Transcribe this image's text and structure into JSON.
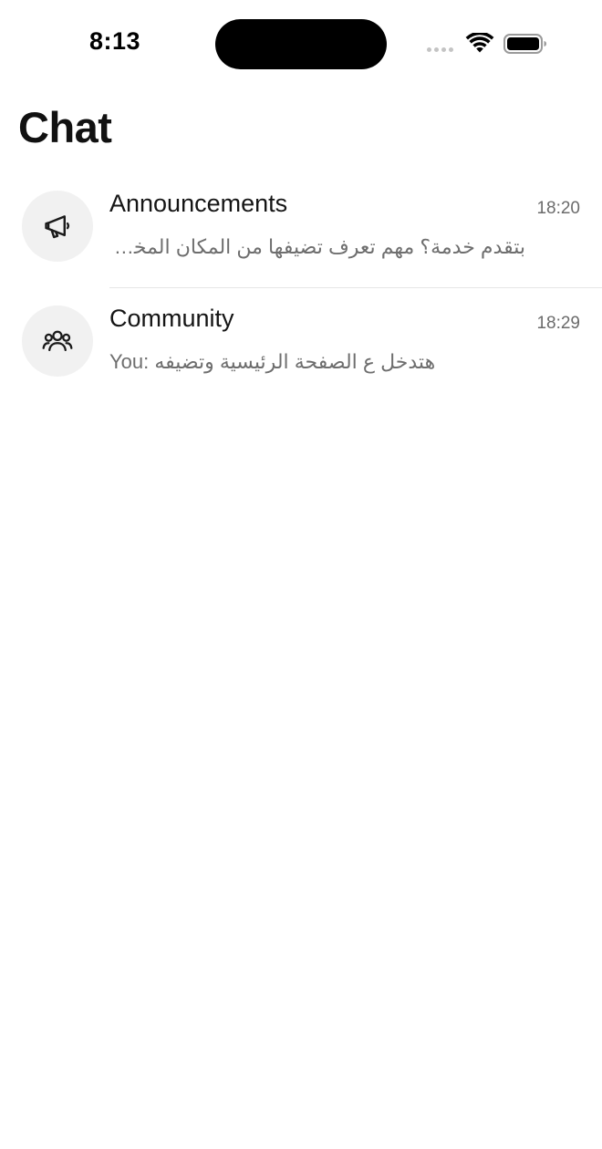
{
  "status_bar": {
    "time": "8:13"
  },
  "header": {
    "title": "Chat"
  },
  "chats": [
    {
      "name": "Announcements",
      "time": "18:20",
      "preview": "بتقدم خدمة؟ مهم تعرف تضيفها من المكان المخصص لها",
      "icon": "megaphone-icon"
    },
    {
      "name": "Community",
      "time": "18:29",
      "preview": "You: هتدخل ع الصفحة الرئيسية وتضيفه",
      "icon": "people-group-icon"
    }
  ],
  "colors": {
    "background": "#ffffff",
    "avatar_bg": "#f1f1f1",
    "secondary_text": "#6e6e6e",
    "divider": "#e7e7e7"
  }
}
